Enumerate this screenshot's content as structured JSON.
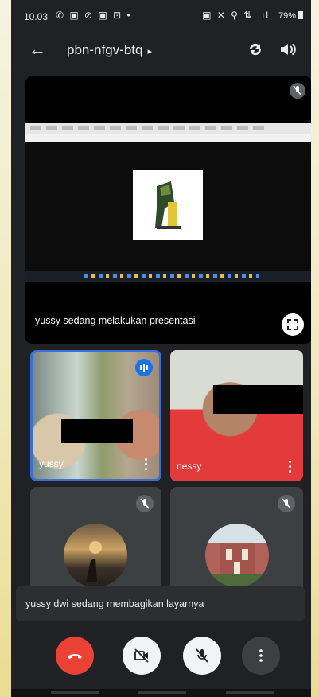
{
  "status_bar": {
    "time": "10.03",
    "left_icons": "✆ ▣ ⊘ ▣ ⊡ •",
    "right_icons": "▣ ✕ ⚲ ⇅ .ıl",
    "battery": "79%"
  },
  "app_bar": {
    "meeting_code": "pbn-nfgv-btq",
    "caret": "▸"
  },
  "presentation": {
    "label": "yussy sedang melakukan presentasi"
  },
  "participants": [
    {
      "name": "yussy",
      "speaking": true
    },
    {
      "name": "nessy",
      "speaking": false
    },
    {
      "name": "",
      "muted": true,
      "avatar": "sunset-photo"
    },
    {
      "name": "",
      "muted": true,
      "avatar": "building-photo"
    }
  ],
  "share_banner": {
    "text": "yussy dwi sedang membagikan layarnya"
  },
  "controls": {
    "end_call_icon": "end-call-icon",
    "camera_icon": "camera-off-icon",
    "mic_icon": "mic-off-icon",
    "more_icon": "more-vert-icon"
  },
  "colors": {
    "background": "#202124",
    "end_call": "#ea4335",
    "speaking": "#1a73e8"
  }
}
